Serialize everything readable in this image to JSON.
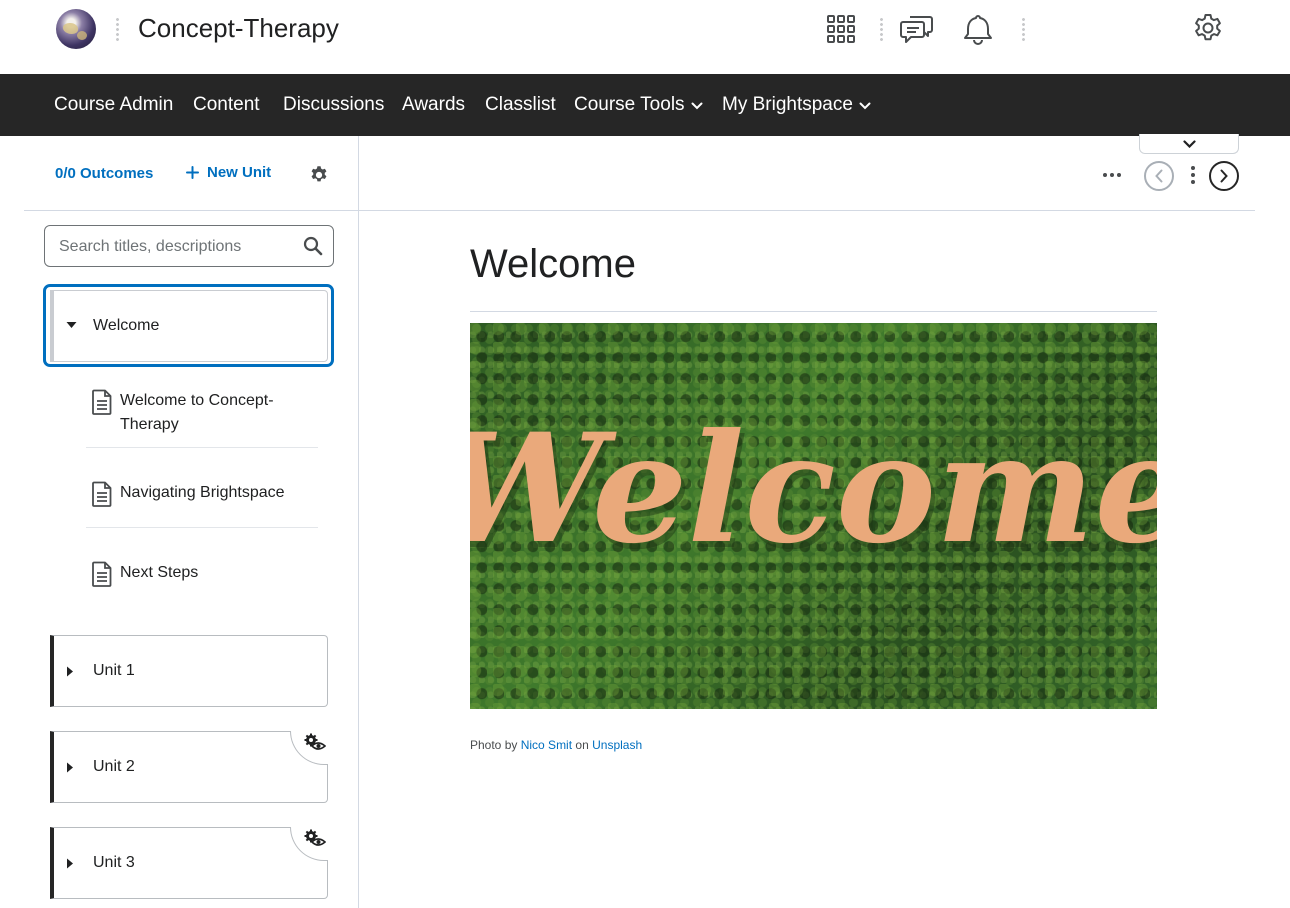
{
  "header": {
    "site_title": "Concept-Therapy",
    "icons": [
      "globe-logo",
      "waffle-grid-icon",
      "message-alerts-icon",
      "bell-icon",
      "gear-icon"
    ]
  },
  "nav": {
    "items": [
      {
        "label": "Course Admin"
      },
      {
        "label": "Content"
      },
      {
        "label": "Discussions"
      },
      {
        "label": "Awards"
      },
      {
        "label": "Classlist"
      },
      {
        "label": "Course Tools",
        "dropdown": true
      },
      {
        "label": "My Brightspace",
        "dropdown": true
      }
    ]
  },
  "sidebar": {
    "outcomes": "0/0 Outcomes",
    "new_unit": "New Unit",
    "search_placeholder": "Search titles, descriptions",
    "units": [
      {
        "title": "Welcome",
        "expanded": true,
        "hidden": false
      },
      {
        "title": "Unit 1",
        "expanded": false,
        "hidden": false
      },
      {
        "title": "Unit 2",
        "expanded": false,
        "hidden": true
      },
      {
        "title": "Unit 3",
        "expanded": false,
        "hidden": true
      }
    ],
    "topics": [
      {
        "title": "Welcome to Concept-Therapy",
        "icon": "document-icon"
      },
      {
        "title": "Navigating Brightspace",
        "icon": "document-icon"
      },
      {
        "title": "Next Steps",
        "icon": "document-icon"
      }
    ]
  },
  "main": {
    "title": "Welcome",
    "hero_text": "Welcome",
    "credit": {
      "prefix": "Photo by",
      "author": "Nico Smit",
      "middle": "on",
      "source": "Unsplash"
    }
  },
  "colors": {
    "accent": "#006fbf",
    "nav_bg": "#262626",
    "border": "#d3d9e3",
    "hero_letters": "#e9a77a"
  }
}
